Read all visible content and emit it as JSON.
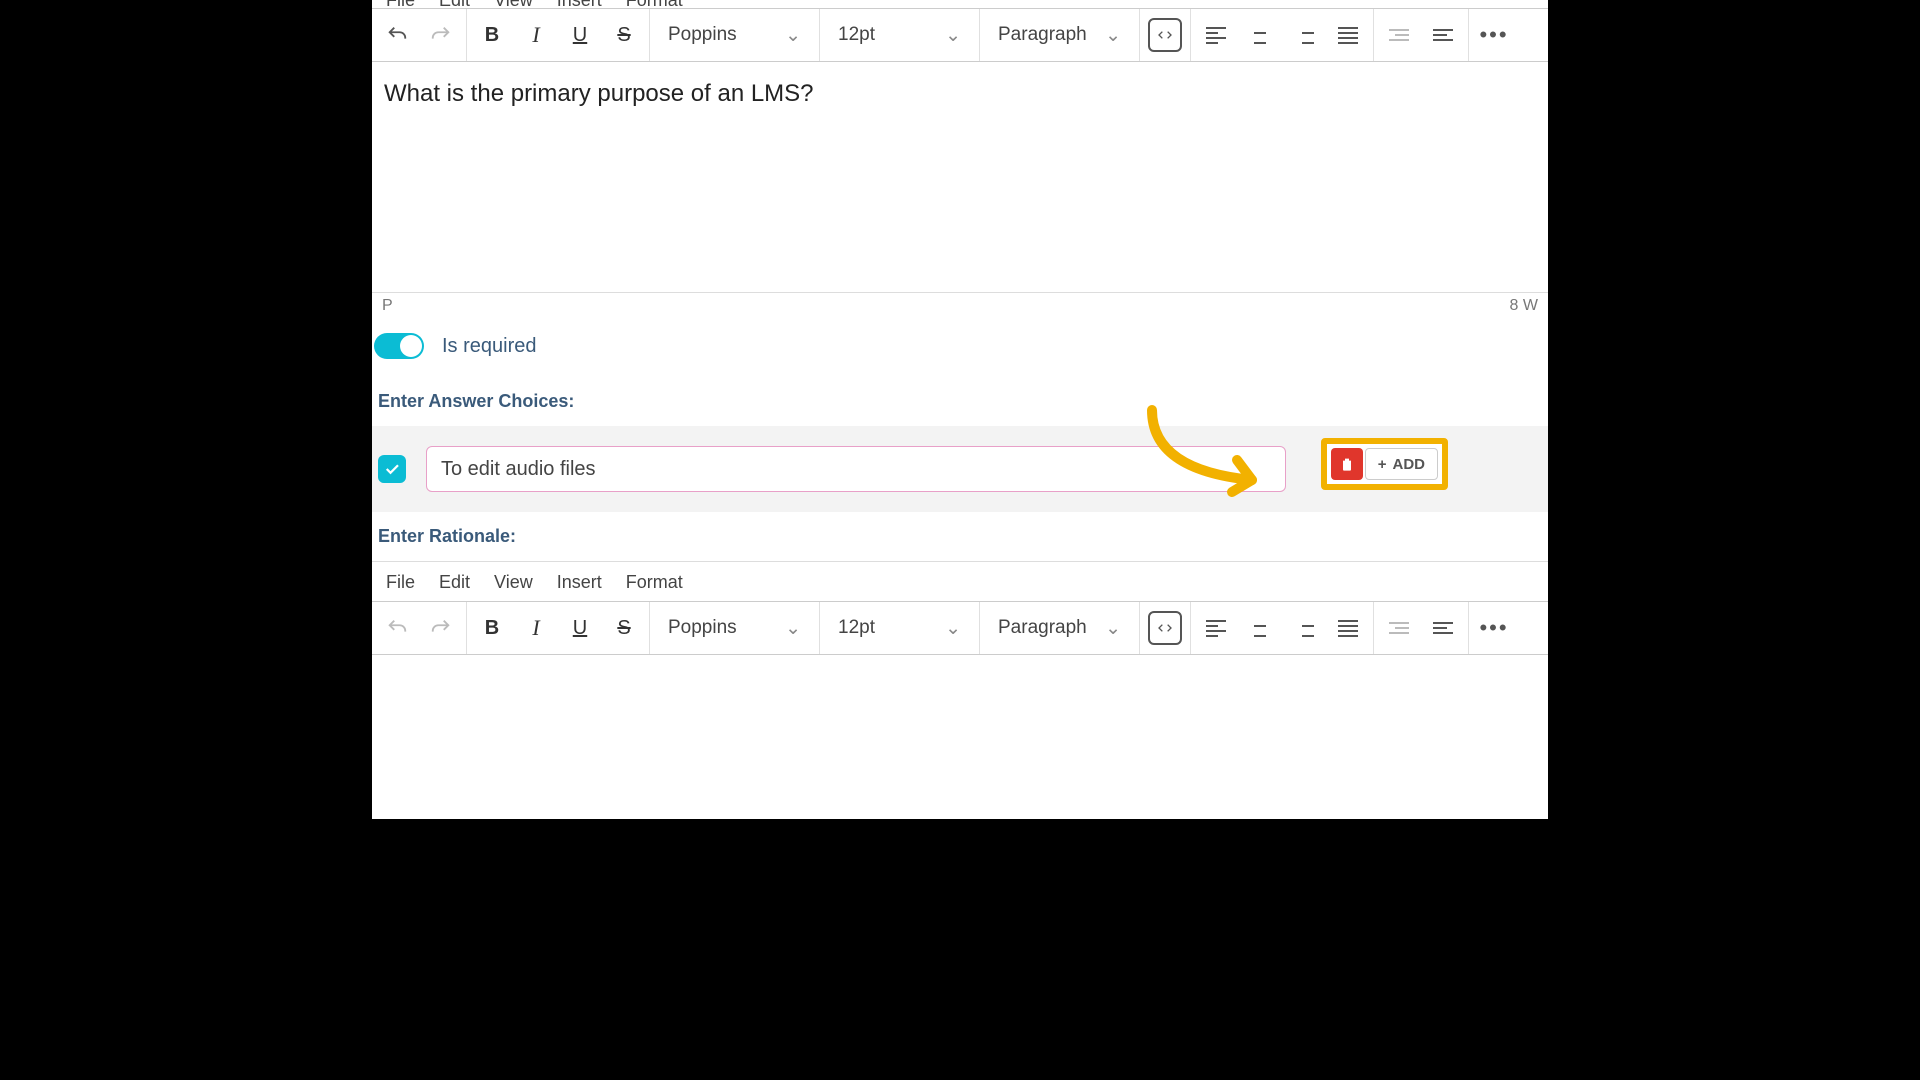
{
  "menu": {
    "file": "File",
    "edit": "Edit",
    "view": "View",
    "insert": "Insert",
    "format": "Format"
  },
  "toolbar": {
    "font": "Poppins",
    "size": "12pt",
    "block": "Paragraph"
  },
  "question": "What is the primary purpose of an LMS?",
  "status": {
    "path": "P",
    "words": "8 W"
  },
  "required_label": "Is required",
  "choices_label": "Enter Answer Choices:",
  "choice_value": "To edit audio files",
  "add_label": "ADD",
  "rationale_label": "Enter Rationale:"
}
